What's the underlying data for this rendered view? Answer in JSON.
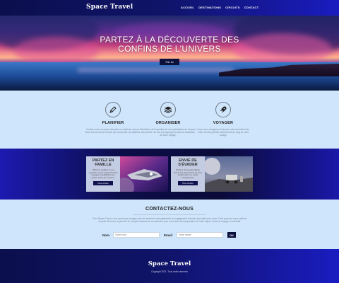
{
  "header": {
    "brand": "Space Travel",
    "nav": [
      "ACCUEIL",
      "DESTINATIONS",
      "CIRCUITS",
      "CONTACT"
    ]
  },
  "hero": {
    "title_line1": "PARTEZ À LA DÉCOUVERTE DES",
    "title_line2": "CONFINS DE L'UNIVERS",
    "button": "Par ici"
  },
  "features": [
    {
      "icon": "pen-icon",
      "title": "PLANIFIER",
      "text": "Confiez-nous vos plans d'évasion au-delà du cosmos. Nous trouverons la formule qui conviendra vos attentes."
    },
    {
      "icon": "layers-icon",
      "title": "ORGANISER",
      "text": "Bénéficiez de l'expertise de nos spécialistes de l'espace découverte, du tout accompagnons dans la réalisation de votre voyage."
    },
    {
      "icon": "rocket-icon",
      "title": "VOYAGER",
      "text": "Nous nous chargeons d'assurer votre sécurité et de veiller à votre parfaite sérénité tout au long de votre voyage."
    }
  ],
  "circuits": [
    {
      "title_line1": "PARTEZ EN",
      "title_line2": "FAMILLE",
      "text": "Offrez le meilleur à vos proches en leur proposant des voyages inoubliables aux quatre coins de l'univers.",
      "button": "Plus d'infos"
    },
    {
      "title_line1": "ENVIE DE",
      "title_line2": "S'ÉVADER",
      "text": "Profitez d'une parenthèse divine à la découverte de lieux inédits dans un cadre exceptionnel.",
      "button": "Plus d'infos"
    }
  ],
  "contact": {
    "title": "CONTACTEZ-NOUS",
    "text": "Chez Space Travel, vous savoir que voyager est une aventure mais également un engagement financier important pour vous. C'est pourquoi nous mettons un point d'honneur à prendre en compte chacune de vos attentes pour vous aider à la préparation de votre séjour. Aussi on voyage en sérénité.",
    "name_label": "Nom",
    "name_placeholder": "Votre nom",
    "email_label": "Email",
    "email_placeholder": "Votre email",
    "submit": "OK"
  },
  "footer": {
    "brand": "Space Travel",
    "copyright": "Copyright 2021. Tous droits réservés"
  },
  "colors": {
    "navy": "#0a0f3c",
    "light_bg": "#cfe5fb",
    "accent_blue": "#1a1cc0"
  }
}
